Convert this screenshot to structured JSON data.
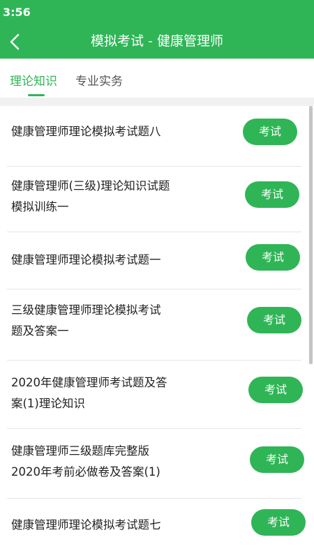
{
  "status_bar": {
    "time": "3:56"
  },
  "header": {
    "title": "模拟考试 - 健康管理师",
    "back_icon": "chevron-left-icon"
  },
  "tabs": [
    {
      "label": "理论知识",
      "active": true
    },
    {
      "label": "专业实务",
      "active": false
    }
  ],
  "colors": {
    "brand": "#2fb556",
    "tab_active": "#2fb556",
    "tab_inactive": "#555555"
  },
  "items": [
    {
      "lines": [
        "健康管理师理论模拟考试题八"
      ],
      "button": "考试"
    },
    {
      "lines": [
        "健康管理师(三级)理论知识试题",
        "模拟训练一"
      ],
      "button": "考试"
    },
    {
      "lines": [
        "健康管理师理论模拟考试题一"
      ],
      "button": "考试"
    },
    {
      "lines": [
        "三级健康管理师理论模拟考试",
        "题及答案一"
      ],
      "button": "考试"
    },
    {
      "lines": [
        "2020年健康管理师考试题及答",
        "案(1)理论知识"
      ],
      "button": "考试"
    },
    {
      "lines": [
        "健康管理师三级题库完整版",
        "2020年考前必做卷及答案(1)"
      ],
      "button": "考试"
    },
    {
      "lines": [
        "健康管理师理论模拟考试题七"
      ],
      "button": "考试"
    }
  ]
}
